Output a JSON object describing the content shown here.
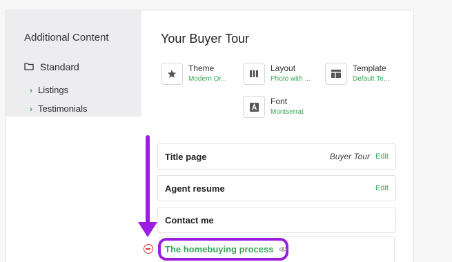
{
  "sidebar": {
    "title": "Additional Content",
    "folder": {
      "label": "Standard",
      "icon": "folder-icon"
    },
    "items": [
      {
        "label": "Listings",
        "icon": "chevron-right-icon"
      },
      {
        "label": "Testimonials",
        "icon": "chevron-right-icon"
      }
    ]
  },
  "main": {
    "title": "Your Buyer Tour",
    "properties": [
      {
        "label": "Theme",
        "value": "Modern Or...",
        "icon": "star-icon"
      },
      {
        "label": "Layout",
        "value": "Photo with ...",
        "icon": "columns-icon"
      },
      {
        "label": "Template",
        "value": "Default Te...",
        "icon": "template-icon"
      },
      {
        "label": "Font",
        "value": "Montserrat",
        "icon": "font-icon"
      }
    ],
    "pages": [
      {
        "name": "Title page",
        "subtitle": "Buyer Tour",
        "edit": "Edit"
      },
      {
        "name": "Agent resume",
        "edit": "Edit"
      },
      {
        "name": "Contact me"
      },
      {
        "name": "The homebuying process",
        "icon": "eye-icon",
        "remove_icon": "remove-circle-icon"
      }
    ]
  },
  "colors": {
    "accent_green": "#3aa657",
    "annotation_purple": "#9b1ee0",
    "remove_red": "#d9363e"
  }
}
